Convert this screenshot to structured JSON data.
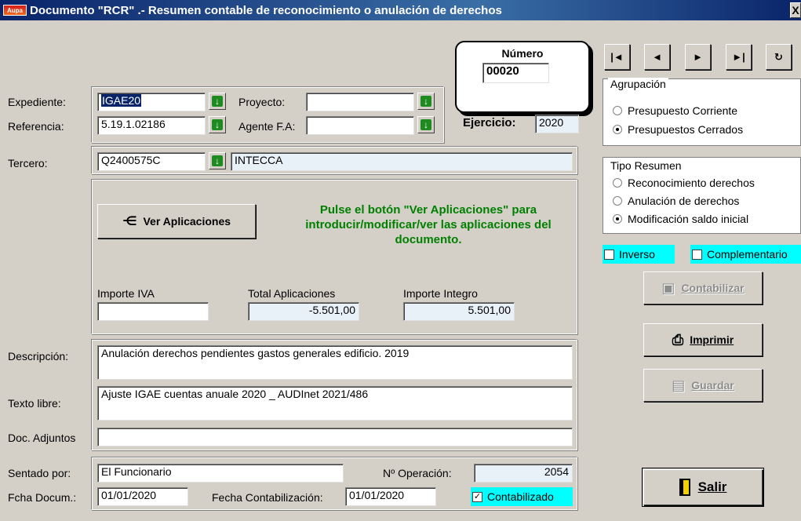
{
  "window": {
    "title": "Documento \"RCR\" .- Resumen contable de reconocimiento o anulación de derechos",
    "close": "X"
  },
  "numero": {
    "label": "Número",
    "value": "00020"
  },
  "nav": {
    "first": "|◄",
    "prev": "◄",
    "next": "►",
    "last": "►|",
    "refresh": "↻"
  },
  "fields": {
    "expediente": {
      "label": "Expediente:",
      "value": "IGAE20"
    },
    "referencia": {
      "label": "Referencia:",
      "value": "5.19.1.02186"
    },
    "proyecto": {
      "label": "Proyecto:",
      "value": ""
    },
    "agente": {
      "label": "Agente F.A:",
      "value": ""
    },
    "ejercicio": {
      "label": "Ejercicio:",
      "value": "2020"
    },
    "tercero": {
      "label": "Tercero:",
      "value": "Q2400575C",
      "name": "INTECCA"
    }
  },
  "aplicaciones": {
    "button": "Ver Aplicaciones",
    "message": "Pulse el botón \"Ver Aplicaciones\" para introducir/modificar/ver las aplicaciones del documento.",
    "importe_iva": {
      "label": "Importe IVA",
      "value": ""
    },
    "total": {
      "label": "Total Aplicaciones",
      "value": "-5.501,00"
    },
    "integro": {
      "label": "Importe Integro",
      "value": "5.501,00"
    }
  },
  "descripcion": {
    "label": "Descripción:",
    "value": "Anulación derechos pendientes gastos generales edificio. 2019"
  },
  "texto_libre": {
    "label": "Texto libre:",
    "value": "Ajuste IGAE cuentas anuale 2020 _ AUDInet 2021/486"
  },
  "doc_adjuntos": {
    "label": "Doc. Adjuntos",
    "value": ""
  },
  "footer": {
    "sentado_label": "Sentado por:",
    "sentado_value": "El Funcionario",
    "operacion_label": "Nº Operación:",
    "operacion_value": "2054",
    "fecha_doc_label": "Fcha Docum.:",
    "fecha_doc_value": "01/01/2020",
    "fecha_cont_label": "Fecha Contabilización:",
    "fecha_cont_value": "01/01/2020",
    "contabilizado_label": "Contabilizado",
    "contabilizado_checked": true
  },
  "agrupacion": {
    "title": "Agrupación",
    "options": [
      {
        "label": "Presupuesto Corriente",
        "selected": false
      },
      {
        "label": "Presupuestos Cerrados",
        "selected": true
      }
    ]
  },
  "tipo_resumen": {
    "title": "Tipo Resumen",
    "options": [
      {
        "label": "Reconocimiento derechos",
        "selected": false
      },
      {
        "label": "Anulación de derechos",
        "selected": false
      },
      {
        "label": "Modificación saldo inicial",
        "selected": true
      }
    ]
  },
  "flags": {
    "inverso": "Inverso",
    "complementario": "Complementario"
  },
  "buttons": {
    "contabilizar": "Contabilizar",
    "imprimir": "Imprimir",
    "guardar": "Guardar",
    "salir": "Salir"
  },
  "colors": {
    "cyan_highlight": "#00ffff",
    "green_text": "#008000",
    "title_blue": "#0a246a"
  }
}
